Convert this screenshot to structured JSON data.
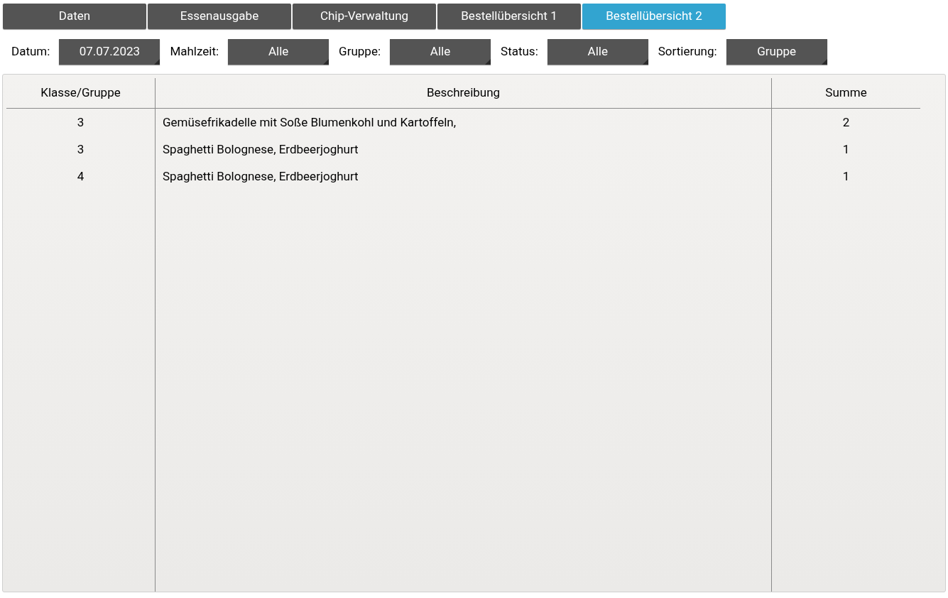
{
  "tabs": [
    {
      "label": "Daten",
      "selected": false
    },
    {
      "label": "Essenausgabe",
      "selected": false
    },
    {
      "label": "Chip-Verwaltung",
      "selected": false
    },
    {
      "label": "Bestellübersicht 1",
      "selected": false
    },
    {
      "label": "Bestellübersicht 2",
      "selected": true
    }
  ],
  "filters": [
    {
      "label": "Datum:",
      "value": "07.07.2023"
    },
    {
      "label": "Mahlzeit:",
      "value": "Alle"
    },
    {
      "label": "Gruppe:",
      "value": "Alle"
    },
    {
      "label": "Status:",
      "value": "Alle"
    },
    {
      "label": "Sortierung:",
      "value": "Gruppe"
    }
  ],
  "table": {
    "columns": [
      "Klasse/Gruppe",
      "Beschreibung",
      "Summe"
    ],
    "rows": [
      [
        "3",
        "Gemüsefrikadelle mit Soße Blumenkohl und Kartoffeln,",
        "2"
      ],
      [
        "3",
        "Spaghetti Bolognese, Erdbeerjoghurt",
        "1"
      ],
      [
        "4",
        "Spaghetti Bolognese, Erdbeerjoghurt",
        "1"
      ]
    ]
  }
}
